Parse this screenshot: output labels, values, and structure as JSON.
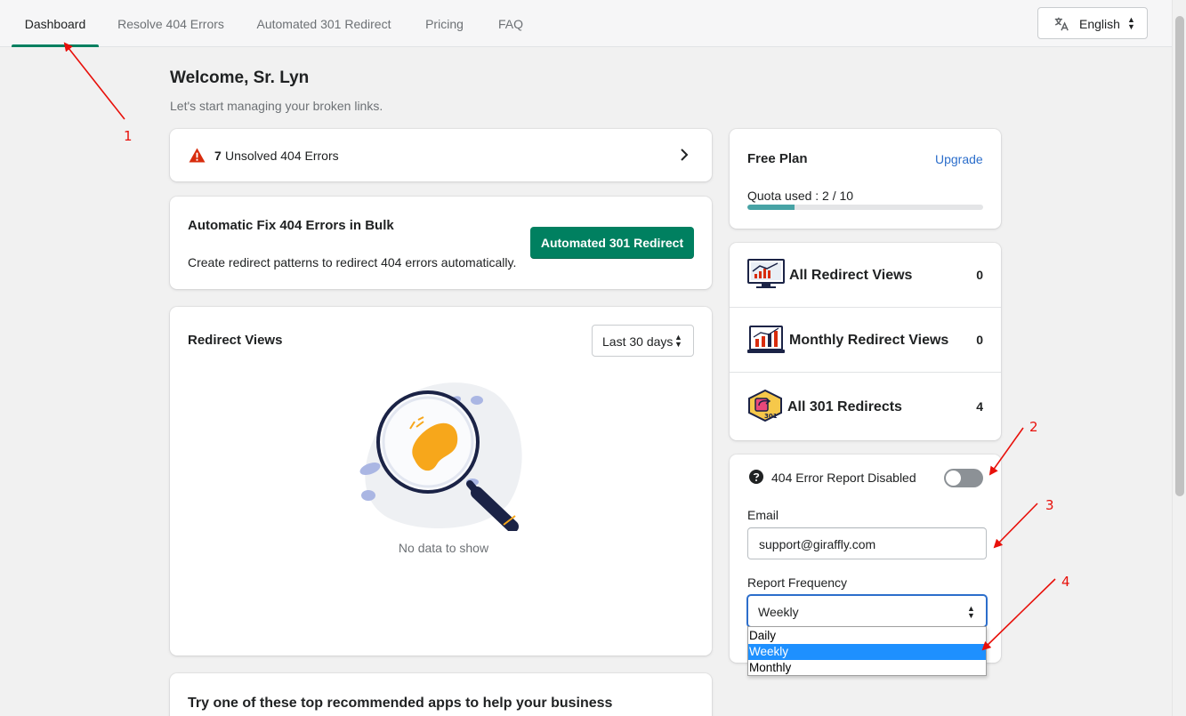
{
  "nav": {
    "tabs": [
      {
        "label": "Dashboard",
        "active": true
      },
      {
        "label": "Resolve 404 Errors"
      },
      {
        "label": "Automated 301 Redirect"
      },
      {
        "label": "Pricing"
      },
      {
        "label": "FAQ"
      }
    ],
    "language": {
      "label": "English",
      "icon": "translate-icon"
    }
  },
  "welcome": {
    "title": "Welcome, Sr. Lyn",
    "subtitle": "Let's start managing your broken links."
  },
  "unsolved": {
    "count": "7",
    "label": "Unsolved 404 Errors",
    "icon": "warning-icon"
  },
  "bulk": {
    "title": "Automatic Fix 404 Errors in Bulk",
    "description": "Create redirect patterns to redirect 404 errors automatically.",
    "button": "Automated 301 Redirect"
  },
  "redirect_views": {
    "title": "Redirect Views",
    "range": "Last 30 days",
    "empty_text": "No data to show"
  },
  "recommended": {
    "title": "Try one of these top recommended apps to help your business"
  },
  "plan": {
    "title": "Free Plan",
    "upgrade": "Upgrade",
    "quota_label": "Quota used : 2 / 10",
    "quota_used": 2,
    "quota_total": 10
  },
  "stats": [
    {
      "label": "All Redirect Views",
      "value": "0",
      "icon": "monitor-chart-icon"
    },
    {
      "label": "Monthly Redirect Views",
      "value": "0",
      "icon": "monthly-chart-icon"
    },
    {
      "label": "All 301 Redirects",
      "value": "4",
      "icon": "redirect-301-icon"
    }
  ],
  "report": {
    "title": "404 Error Report Disabled",
    "enabled": false,
    "email_label": "Email",
    "email_value": "support@giraffly.com",
    "frequency_label": "Report Frequency",
    "frequency_value": "Weekly",
    "frequency_options": [
      "Daily",
      "Weekly",
      "Monthly"
    ]
  },
  "annotations": [
    "1",
    "2",
    "3",
    "4"
  ],
  "colors": {
    "primary": "#008060",
    "link": "#2c6ecb",
    "annotation": "#e8100a",
    "quota_fill": "#47a3a5",
    "option_highlight": "#1e90ff"
  }
}
